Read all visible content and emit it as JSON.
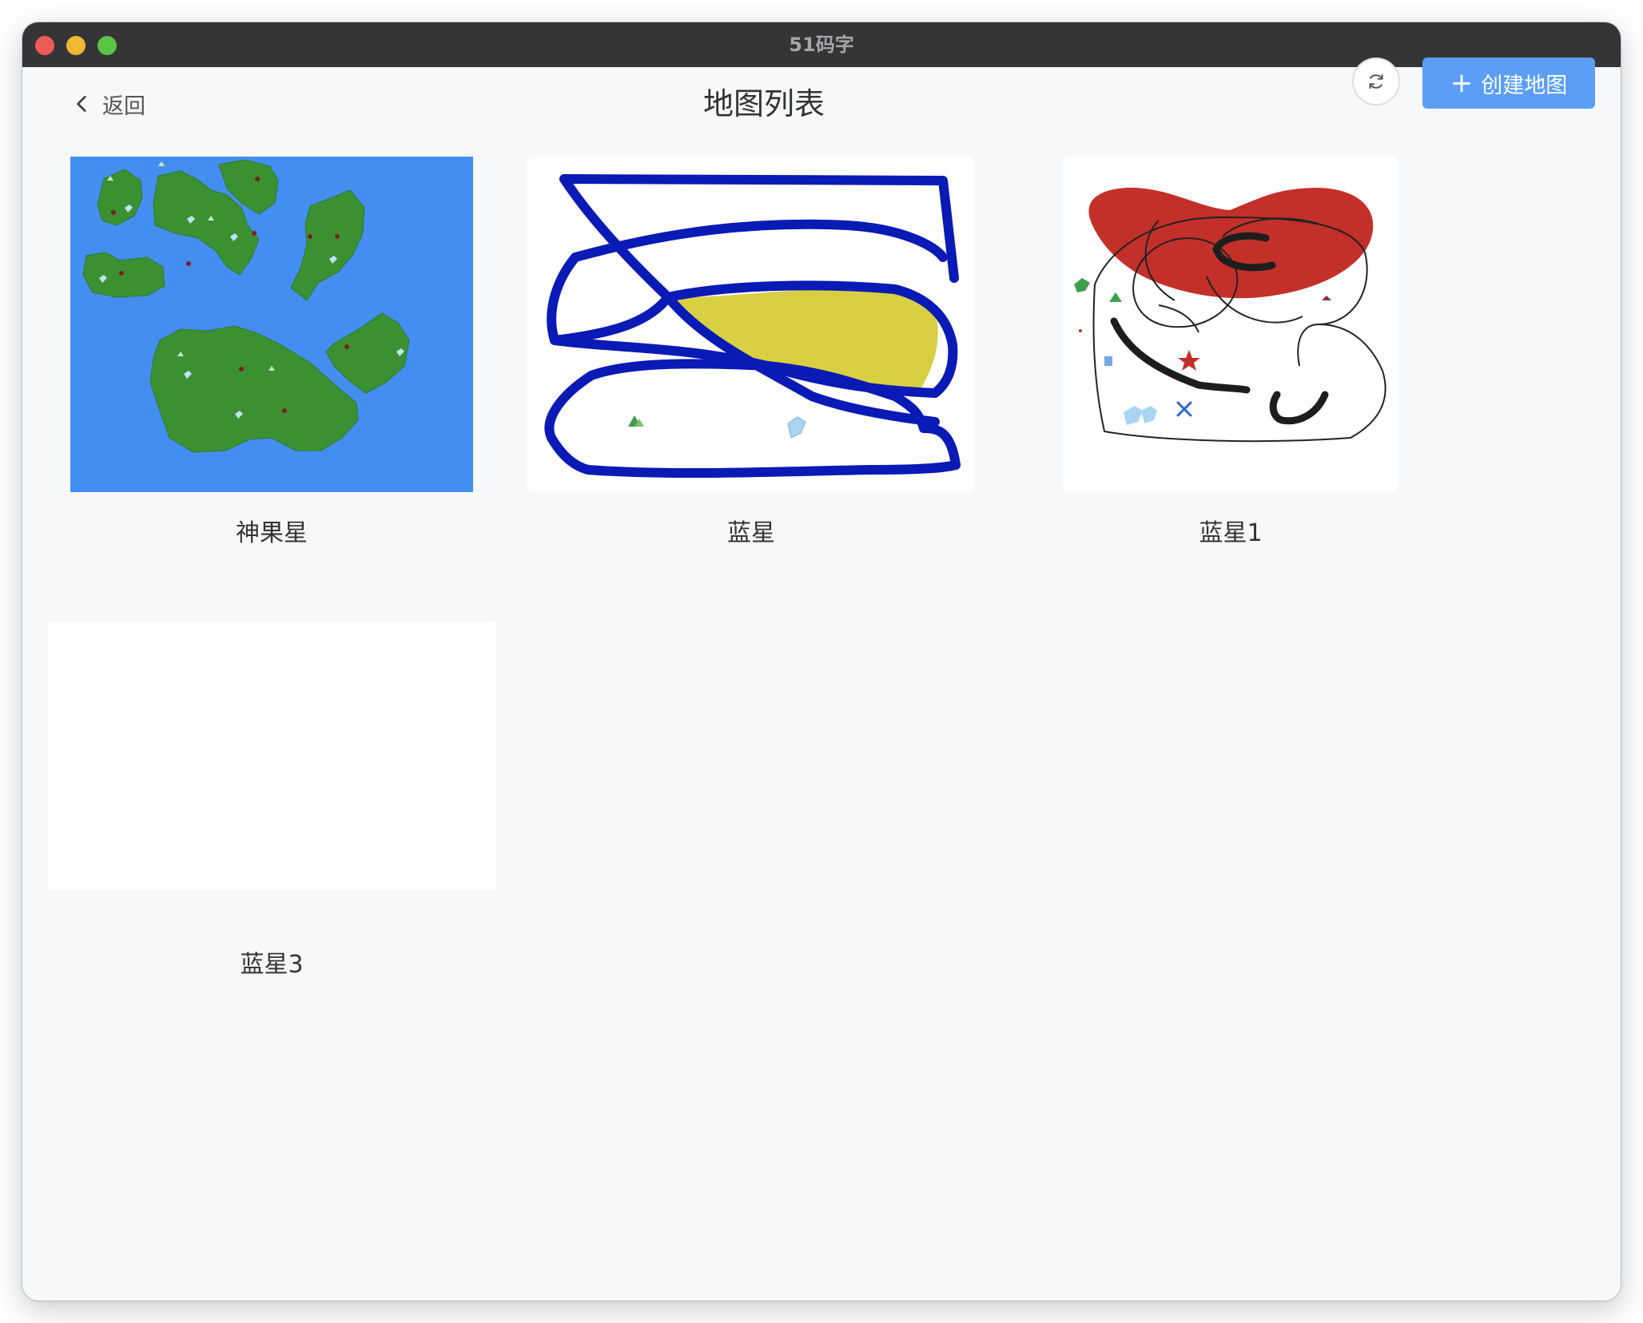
{
  "window": {
    "title": "51码字"
  },
  "header": {
    "back_label": "返回",
    "title": "地图列表",
    "create_label": "创建地图"
  },
  "maps": [
    {
      "name": "神果星"
    },
    {
      "name": "蓝星"
    },
    {
      "name": "蓝星1"
    },
    {
      "name": "蓝星3"
    }
  ],
  "icons": {
    "back": "chevron-left-icon",
    "refresh": "refresh-icon",
    "create": "plus-icon"
  },
  "colors": {
    "titlebar": "#353538",
    "primary": "#5b9ef8",
    "ocean": "#448ef2",
    "land": "#3b9132",
    "stroke_blue": "#0a1ab4",
    "fill_yellow": "#d8cf42",
    "fill_red": "#c3302a"
  }
}
